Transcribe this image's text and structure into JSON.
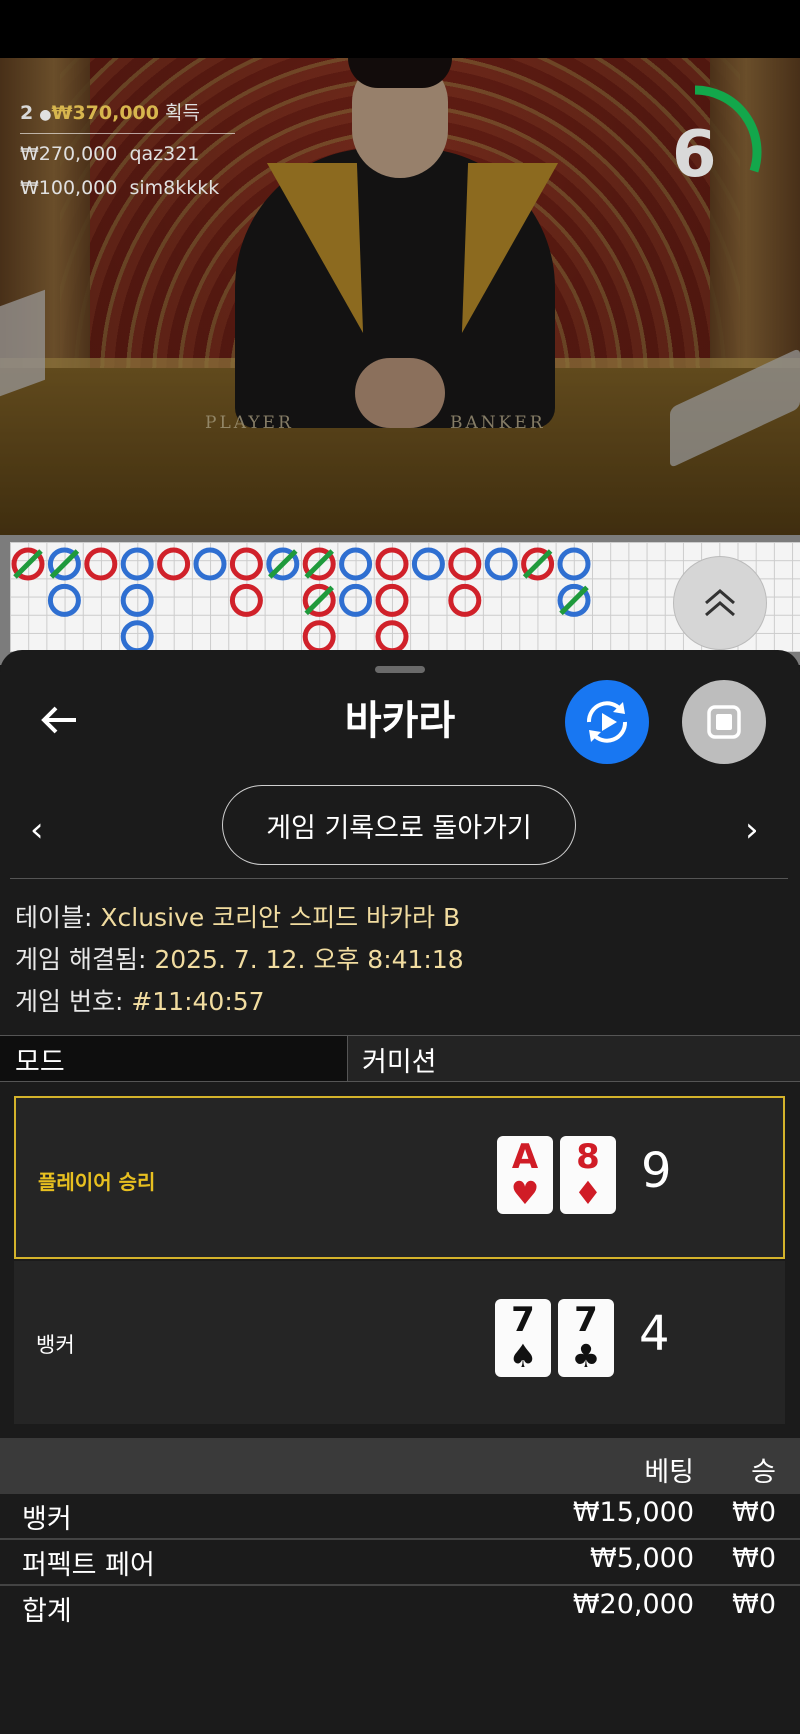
{
  "video": {
    "winners_count": "2",
    "winners_total": "₩370,000",
    "winners_suffix": "획득",
    "winners": [
      {
        "amount": "₩270,000",
        "user": "qaz321"
      },
      {
        "amount": "₩100,000",
        "user": "sim8kkkk"
      }
    ],
    "timer": "6",
    "timer_progress": 0.3,
    "table_player": "PLAYER",
    "table_banker": "BANKER"
  },
  "header": {
    "title": "바카라"
  },
  "nav": {
    "history_label": "게임 기록으로 돌아가기",
    "prev": "‹",
    "next": "›"
  },
  "info": {
    "table_label": "테이블:",
    "table_value": "Xclusive 코리안 스피드 바카라 B",
    "resolved_label": "게임 해결됨:",
    "resolved_value": "2025. 7. 12. 오후 8:41:18",
    "number_label": "게임 번호:",
    "number_value": "#11:40:57"
  },
  "mode": {
    "label": "모드",
    "value": "커미션"
  },
  "hands": [
    {
      "label": "플레이어 승리",
      "cards": [
        {
          "rank": "A",
          "suit": "♥",
          "color": "red"
        },
        {
          "rank": "8",
          "suit": "♦",
          "color": "red"
        }
      ],
      "total": "9"
    },
    {
      "label": "뱅커",
      "cards": [
        {
          "rank": "7",
          "suit": "♠",
          "color": "blk"
        },
        {
          "rank": "7",
          "suit": "♣",
          "color": "blk"
        }
      ],
      "total": "4"
    }
  ],
  "bets": {
    "col_bet": "베팅",
    "col_win": "승",
    "rows": [
      {
        "name": "뱅커",
        "bet": "₩15,000",
        "win": "₩0"
      },
      {
        "name": "퍼펙트 페어",
        "bet": "₩5,000",
        "win": "₩0"
      },
      {
        "name": "합계",
        "bet": "₩20,000",
        "win": "₩0"
      }
    ]
  },
  "colors": {
    "accent_blue": "#1877f2",
    "player_blue": "#2f6fd1",
    "banker_red": "#d0212a",
    "winner_gold": "#d4b32b"
  }
}
